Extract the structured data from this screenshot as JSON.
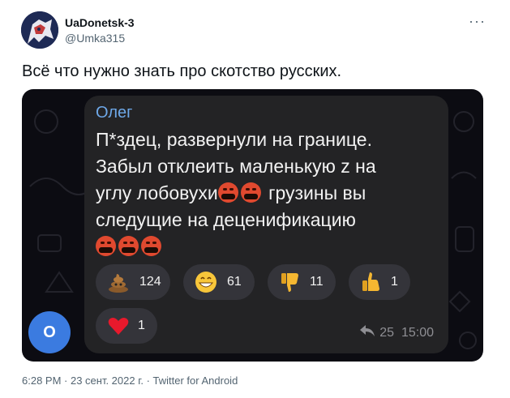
{
  "author": {
    "display_name": "UaDonetsk-3",
    "handle": "@Umka315"
  },
  "tweet": {
    "text": "Всё что нужно знать про скотство русских.",
    "more_glyph": "···",
    "footer": "6:28 PM · 23 сент. 2022 г. · Twitter for Android"
  },
  "screenshot": {
    "sender": "Олег",
    "message_lines": [
      "П*здец, развернули на границе.",
      "Забыл отклеить маленькую z на",
      "углу лобовухи",
      " грузины вы",
      "следущие на деценификацию"
    ],
    "reactions": [
      {
        "emoji": "pile-of-poo",
        "count": "124"
      },
      {
        "emoji": "grinning-face",
        "count": "61"
      },
      {
        "emoji": "thumbs-down",
        "count": "11"
      },
      {
        "emoji": "thumbs-up",
        "count": "1"
      },
      {
        "emoji": "red-heart",
        "count": "1"
      }
    ],
    "views": "25",
    "time": "15:00",
    "avatar_letter": "O"
  },
  "colors": {
    "sender": "#6ea8e8",
    "bubble": "#232325",
    "avatar_blue": "#3b7be0",
    "rage_emoji": "#e0492f"
  }
}
